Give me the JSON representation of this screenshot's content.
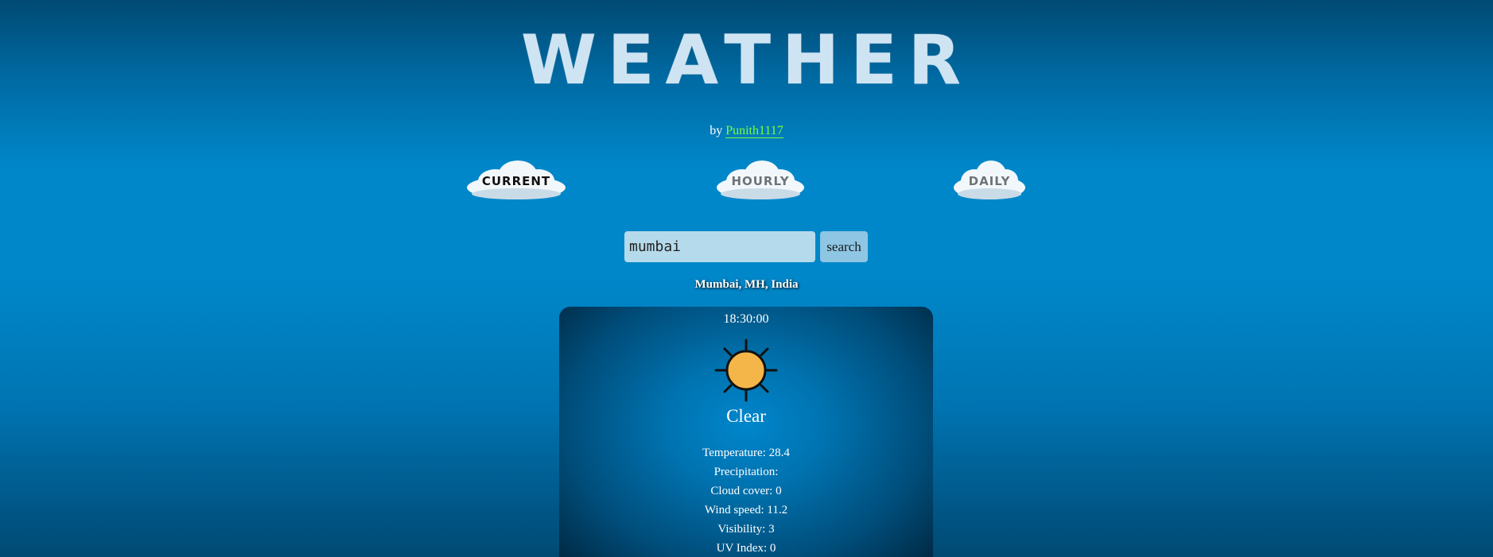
{
  "header": {
    "title": "WEATHER",
    "by_prefix": "by",
    "author": "Punith1117"
  },
  "nav": {
    "current": "CURRENT",
    "hourly": "HOURLY",
    "daily": "DAILY"
  },
  "search": {
    "value": "mumbai",
    "button_label": "search"
  },
  "location": "Mumbai, MH, India",
  "card": {
    "time": "18:30:00",
    "condition": "Clear",
    "icon": "sun-icon",
    "stats": [
      {
        "label": "Temperature:",
        "value": "28.4"
      },
      {
        "label": "Precipitation:",
        "value": ""
      },
      {
        "label": "Cloud cover:",
        "value": "0"
      },
      {
        "label": "Wind speed:",
        "value": "11.2"
      },
      {
        "label": "Visibility:",
        "value": "3"
      },
      {
        "label": "UV Index:",
        "value": "0"
      }
    ]
  },
  "colors": {
    "author_link": "#7dff3a",
    "sun_fill": "#f4b649",
    "title": "#cfe4f2"
  }
}
